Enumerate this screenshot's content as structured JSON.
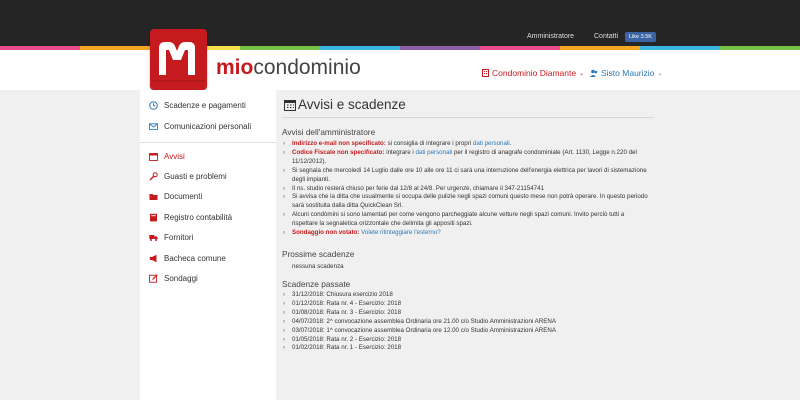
{
  "topnav": {
    "admin": "Amministratore",
    "contacts": "Contatti",
    "fb_like": "Like 3.5K"
  },
  "brand": {
    "colors": {
      "primary": "#c51a1e",
      "link": "#2d79b8",
      "topbar": "#252525"
    },
    "stripe": [
      "#e84c8b",
      "#f5a623",
      "#f7e14a",
      "#7ac143",
      "#3cb6e3",
      "#8e5ea2",
      "#e84c8b",
      "#f5a623",
      "#3cb6e3",
      "#7ac143"
    ]
  },
  "logo": {
    "mio": "mio",
    "rest": "condominio"
  },
  "header": {
    "condo": "Condominio Diamante",
    "user": "Sisto Maurizio"
  },
  "sidebar": {
    "items": [
      {
        "label": "Scadenze e pagamenti",
        "icon": "clock-icon"
      },
      {
        "label": "Comunicazioni personali",
        "icon": "envelope-icon"
      },
      {
        "label": "Avvisi",
        "icon": "calendar-icon"
      },
      {
        "label": "Guasti e problemi",
        "icon": "wrench-icon"
      },
      {
        "label": "Documenti",
        "icon": "folder-icon"
      },
      {
        "label": "Registro contabilità",
        "icon": "book-icon"
      },
      {
        "label": "Fornitori",
        "icon": "truck-icon"
      },
      {
        "label": "Bacheca comune",
        "icon": "megaphone-icon"
      },
      {
        "label": "Sondaggi",
        "icon": "edit-icon"
      }
    ]
  },
  "main": {
    "title": "Avvisi e scadenze",
    "admin_section": "Avvisi dell'amministratore",
    "notices": {
      "n1_red": "Indirizzo e-mail non specificato:",
      "n1_text": " si consiglia di integrare i propri ",
      "n1_link": "dati personali",
      "n1_end": ".",
      "n2_red": "Codice Fiscale non specificato:",
      "n2_text": " integrare i ",
      "n2_link": "dati personali",
      "n2_end": " per il registro di anagrafe condominiale (Art. 1130, Legge n.220 del 11/12/2012).",
      "n3": "Si segnala che mercoledì 14 Luglio dalle ore 10 alle ore 11 ci sarà una interruzione dell'energia elettrica per lavori di sistemazione degli impianti.",
      "n4": "Il ns. studio resterà chiuso per ferie dal 12/8 al 24/8. Per urgenze, chiamare il 347-21154741",
      "n5": "Si avvisa che la ditta che usualmente si occupa delle pulizie negli spazi comuni questo mese non potrà operare. In questo periodo sarà sostituita dalla ditta QuickClean Srl.",
      "n6": "Alcuni condòmini si sono lamentati per come vengono parcheggiate alcune vetture negli spazi comuni. Invito perciò tutti a rispettare la segnaletica orizzontale che delimita gli appositi spazi.",
      "n7_red": "Sondaggio non votato:",
      "n7_link": "Volete ritinteggiare l'esterno?"
    },
    "upcoming_section": "Prossime scadenze",
    "upcoming_none": "nessuna scadenza",
    "past_section": "Scadenze passate",
    "past": [
      "31/12/2018: Chiusura esercizio 2018",
      "01/12/2018: Rata nr. 4 - Esercizio: 2018",
      "01/08/2018: Rata nr. 3 - Esercizio: 2018",
      "04/07/2018: 2^ convocazione assemblea Ordinaria ore 21.00 c/o Studio Amministrazioni ARENA",
      "03/07/2018: 1^ convocazione assemblea Ordinaria ore 12.00 c/o Studio Amministrazioni ARENA",
      "01/05/2018: Rata nr. 2 - Esercizio: 2018",
      "01/02/2018: Rata nr. 1 - Esercizio: 2018"
    ]
  }
}
